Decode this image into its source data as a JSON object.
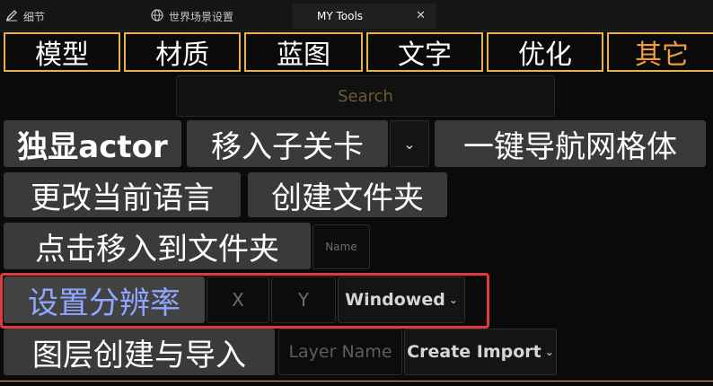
{
  "tabs": [
    {
      "label": "细节",
      "icon": "edit-icon"
    },
    {
      "label": "世界场景设置",
      "icon": "globe-icon"
    },
    {
      "label": "MY Tools",
      "icon": "",
      "active": true
    }
  ],
  "close_symbol": "✕",
  "categories": [
    "模型",
    "材质",
    "蓝图",
    "文字",
    "优化",
    "其它"
  ],
  "active_category": "其它",
  "search": {
    "placeholder": "Search"
  },
  "tools": {
    "isolate_actor": "独显actor",
    "move_to_sublevel": "移入子关卡",
    "sublevel_dropdown_chevron": "⌄",
    "navmesh_oneclick": "一键导航网格体",
    "change_language": "更改当前语言",
    "create_folder": "创建文件夹",
    "click_move_to_folder": "点击移入到文件夹",
    "folder_name_placeholder": "Name",
    "set_resolution": "设置分辨率",
    "res_x_placeholder": "X",
    "res_y_placeholder": "Y",
    "window_mode": "Windowed",
    "layer_create_import": "图层创建与导入",
    "layer_name_placeholder": "Layer Name",
    "create_import": "Create Import"
  },
  "colors": {
    "category_border": "#e7b24b",
    "active_category_text": "#f29c3b",
    "highlight_text": "#8fa7ff",
    "highlight_outline": "#e03a3a"
  }
}
